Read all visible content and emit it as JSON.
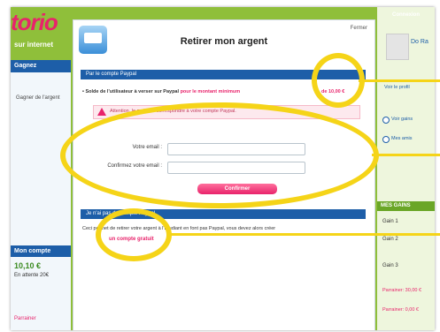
{
  "left": {
    "logo": "torio",
    "tagline": "sur internet",
    "section1_header": "Gagnez",
    "link": "Gagner de l'argent",
    "section2_header": "Mon compte",
    "balance": "10,10 €",
    "balance_sub": "En attente 20€",
    "red_text": "Parrainer"
  },
  "dialog": {
    "title": "Retirer mon argent",
    "close": "Fermer",
    "section1": "Par le compte Paypal",
    "balance_text": "Solde de l'utilisateur à verser sur Paypal",
    "balance_red": "pour le montant minimum",
    "balance_amount": "de 10,00 €",
    "warning": "Attention, le mail doit correspondre à votre compte Paypal.",
    "email_label": "Votre email :",
    "confirm_email_label": "Confirmez votre email :",
    "email_value": "",
    "confirm_email_value": "",
    "confirm_button": "Confirmer",
    "section2": "Je n'ai pas de compte Paypal",
    "help_text": "Ceci permet de retirer votre argent à l'Etudiant en font pas Paypal, vous devez alors créer",
    "help_link": "un compte gratuit"
  },
  "right": {
    "header": "Connexion",
    "name": "Do Ra",
    "link1": "Voir le profil",
    "link2": "Voir gains",
    "link3": "Mes amis",
    "header2": "MES GAINS",
    "item1": "Gain 1",
    "item2": "Gain 2",
    "item3": "Gain 3",
    "red1": "Parrainer: 30,00 €",
    "red2": "Parrainer: 0,00 €"
  }
}
